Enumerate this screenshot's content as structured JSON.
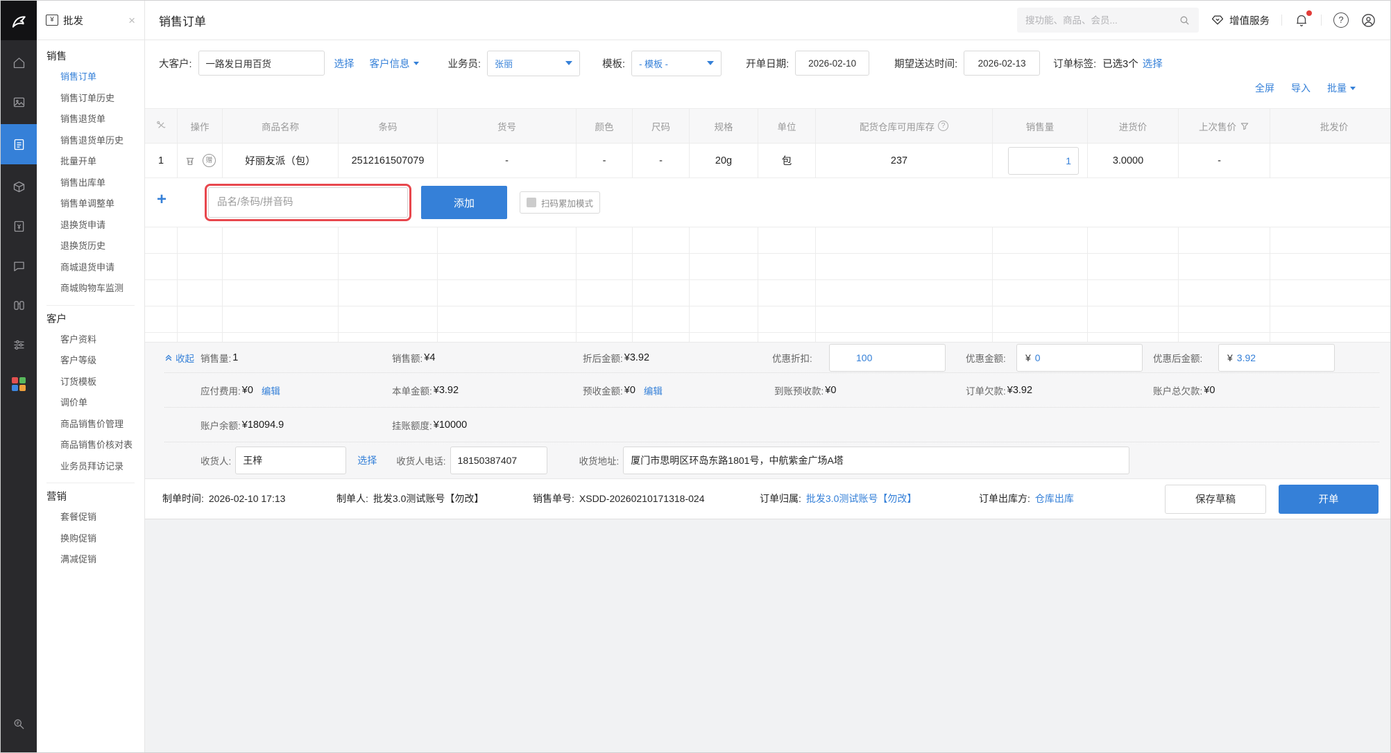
{
  "colors": {
    "primary": "#3580d8",
    "annotation_red": "#e8474d",
    "notification_dot": "#e23c39"
  },
  "icons": {
    "iconbar": [
      "logo-icon",
      "home-icon",
      "gallery-icon",
      "orders-icon",
      "package-icon",
      "invoice-icon",
      "chat-icon",
      "binoculars-icon",
      "sliders-icon",
      "apps-color-grid-icon",
      "search-list-icon"
    ],
    "topbar": [
      "search-icon",
      "vas-gem-icon",
      "bell-icon",
      "help-icon",
      "user-icon"
    ]
  },
  "tab": {
    "label": "批发",
    "icon_glyph": "¥",
    "close": "×"
  },
  "sidebar": {
    "sections": [
      {
        "title": "销售",
        "items": [
          "销售订单",
          "销售订单历史",
          "销售退货单",
          "销售退货单历史",
          "批量开单",
          "销售出库单",
          "销售单调整单",
          "退换货申请",
          "退换货历史",
          "商城退货申请",
          "商城购物车监测"
        ]
      },
      {
        "title": "客户",
        "items": [
          "客户资料",
          "客户等级",
          "订货模板",
          "调价单",
          "商品销售价管理",
          "商品销售价核对表",
          "业务员拜访记录"
        ]
      },
      {
        "title": "营销",
        "items": [
          "套餐促销",
          "换购促销",
          "满减促销"
        ]
      }
    ]
  },
  "topbar": {
    "title": "销售订单",
    "search_placeholder": "搜功能、商品、会员...",
    "vas_label": "增值服务"
  },
  "filters": {
    "customer": {
      "label": "大客户:",
      "value": "一路发日用百货",
      "select": "选择",
      "info": "客户信息"
    },
    "salesman": {
      "label": "业务员:",
      "value": "张丽"
    },
    "template": {
      "label": "模板:",
      "value": "- 模板 -"
    },
    "order_date": {
      "label": "开单日期:",
      "value": "2026-02-10"
    },
    "expected_date": {
      "label": "期望送达时间:",
      "value": "2026-02-13"
    },
    "tags": {
      "label": "订单标签:",
      "value": "已选3个",
      "select": "选择"
    },
    "actions": [
      "全屏",
      "导入",
      "批量"
    ]
  },
  "table": {
    "headers": [
      "操作",
      "商品名称",
      "条码",
      "货号",
      "颜色",
      "尺码",
      "规格",
      "单位",
      "配货仓库可用库存",
      "销售量",
      "进货价",
      "上次售价",
      "批发价"
    ],
    "row": {
      "index": "1",
      "gift_badge": "赠",
      "name": "好丽友派（包）",
      "barcode": "2512161507079",
      "item_no": "-",
      "color": "-",
      "size": "-",
      "spec": "20g",
      "unit": "包",
      "stock": "237",
      "qty": "1",
      "purchase_price": "3.0000",
      "last_price": "-",
      "wholesale_price": ""
    },
    "add_row": {
      "plus": "+",
      "placeholder": "品名/条码/拼音码",
      "add_button": "添加",
      "scan_mode_label": "扫码累加模式"
    }
  },
  "summary": {
    "collapse": "收起",
    "qty": {
      "label": "销售量:",
      "value": "1"
    },
    "amount": {
      "label": "销售额:",
      "value": "¥4"
    },
    "discounted_amount": {
      "label": "折后金额:",
      "value": "¥3.92"
    },
    "discount_rate": {
      "label": "优惠折扣:",
      "value": "100"
    },
    "discount_amount": {
      "label": "优惠金额:",
      "prefix": "¥",
      "value": "0"
    },
    "after_discount": {
      "label": "优惠后金额:",
      "prefix": "¥",
      "value": "3.92"
    },
    "payable_fee": {
      "label": "应付费用:",
      "value": "¥0",
      "edit": "编辑"
    },
    "order_amount": {
      "label": "本单金额:",
      "value": "¥3.92"
    },
    "prepay": {
      "label": "预收金额:",
      "value": "¥0",
      "edit": "编辑"
    },
    "received_prepay": {
      "label": "到账预收款:",
      "value": "¥0"
    },
    "order_debt": {
      "label": "订单欠款:",
      "value": "¥3.92"
    },
    "account_total_debt": {
      "label": "账户总欠款:",
      "value": "¥0"
    },
    "account_balance": {
      "label": "账户余额:",
      "value": "¥18094.9"
    },
    "credit_limit": {
      "label": "挂账额度:",
      "value": "¥10000"
    },
    "consignee": {
      "label": "收货人:",
      "value": "王梓",
      "select": "选择"
    },
    "phone": {
      "label": "收货人电话:",
      "value": "18150387407"
    },
    "address": {
      "label": "收货地址:",
      "value": "厦门市思明区环岛东路1801号，中航紫金广场A塔"
    }
  },
  "footer": {
    "created_time": {
      "label": "制单时间:",
      "value": "2026-02-10 17:13"
    },
    "creator": {
      "label": "制单人:",
      "value": "批发3.0测试账号【勿改】"
    },
    "order_no": {
      "label": "销售单号:",
      "value": "XSDD-20260210171318-024"
    },
    "owner": {
      "label": "订单归属:",
      "value": "批发3.0测试账号【勿改】"
    },
    "outbound": {
      "label": "订单出库方:",
      "value": "仓库出库"
    },
    "save_draft": "保存草稿",
    "submit": "开单"
  }
}
